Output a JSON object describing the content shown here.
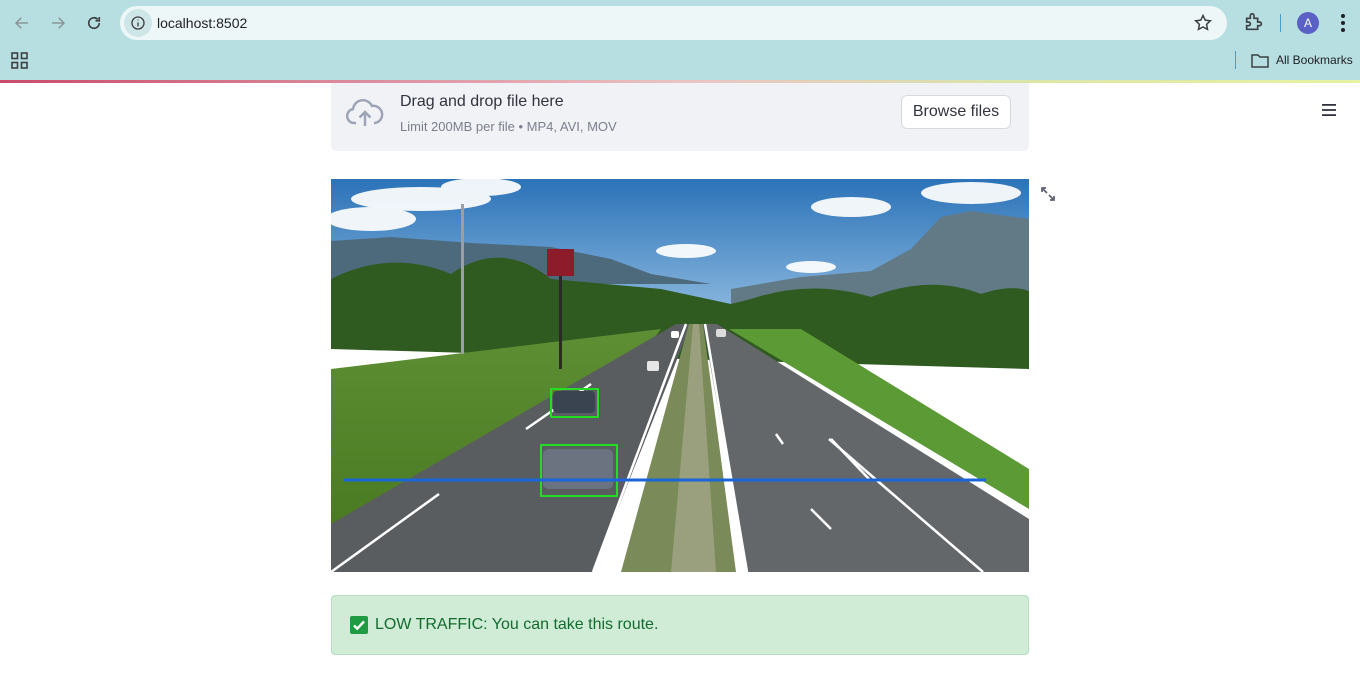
{
  "browser": {
    "url": "localhost:8502",
    "profile_initial": "A",
    "bookmarks_label": "All Bookmarks"
  },
  "icons": [
    "back-arrow-icon",
    "forward-arrow-icon",
    "reload-icon",
    "site-info-icon",
    "star-icon",
    "extensions-icon",
    "chrome-menu-icon",
    "apps-grid-icon",
    "folder-icon",
    "cloud-upload-icon",
    "hamburger-menu-icon",
    "fullscreen-icon",
    "check-mark-icon"
  ],
  "uploader": {
    "title": "Drag and drop file here",
    "limit_text": "Limit 200MB per file • MP4, AVI, MOV",
    "browse_label": "Browse files"
  },
  "video": {
    "description_colors": {
      "detection_box": "#22dd22",
      "counting_line": "#1a66d9"
    },
    "detections_visible": 2
  },
  "alert": {
    "message": "LOW TRAFFIC: You can take this route.",
    "background": "#d0ecd6",
    "text_color": "#136b2f"
  }
}
